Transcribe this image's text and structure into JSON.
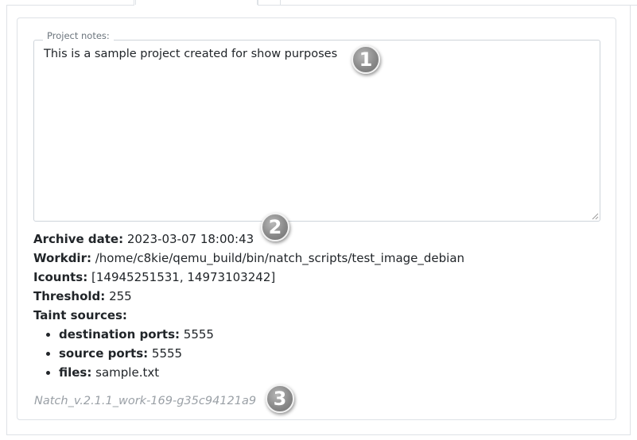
{
  "notes": {
    "legend": "Project notes:",
    "text": "This is a sample project created for show purposes"
  },
  "archive": {
    "archive_date_label": "Archive date:",
    "archive_date_value": "2023-03-07 18:00:43",
    "workdir_label": "Workdir:",
    "workdir_value": "/home/c8kie/qemu_build/bin/natch_scripts/test_image_debian",
    "icounts_label": "Icounts:",
    "icounts_value": "[14945251531, 14973103242]",
    "threshold_label": "Threshold:",
    "threshold_value": "255",
    "taint_sources_label": "Taint sources:",
    "taint_sources": [
      {
        "label": "destination ports:",
        "value": "5555"
      },
      {
        "label": "source ports:",
        "value": "5555"
      },
      {
        "label": "files:",
        "value": "sample.txt"
      }
    ]
  },
  "version": "Natch_v.2.1.1_work-169-g35c94121a9",
  "markers": [
    "1",
    "2",
    "3"
  ],
  "colors": {
    "border": "#dee2e6",
    "text": "#212529",
    "muted": "#9aa0a6",
    "marker": "#8a8a8a"
  }
}
